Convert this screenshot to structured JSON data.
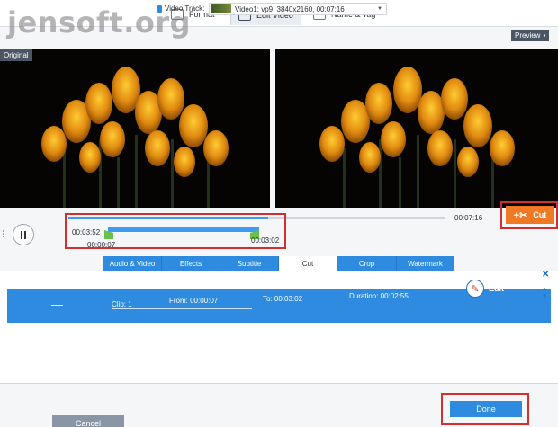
{
  "watermark": "jensoft.org",
  "tabs": [
    {
      "label": "Format",
      "icon": "format-icon"
    },
    {
      "label": "Edit Video",
      "icon": "film-icon"
    },
    {
      "label": "Name & Tag",
      "icon": "tag-icon"
    }
  ],
  "track": {
    "label": "Video Track:",
    "value": "Video1: vp9, 3840x2160, 00:07:16"
  },
  "panes": {
    "original_label": "Original",
    "preview_label": "Preview"
  },
  "timeline": {
    "current": "00:03:52",
    "end": "00:07:16",
    "start_mark": "00:00:07",
    "stop_mark": "00:03:02",
    "progress": 0.53
  },
  "cut_button": "Cut",
  "edit_tabs": [
    "Audio & Video",
    "Effects",
    "Subtitle",
    "Cut",
    "Crop",
    "Watermark"
  ],
  "clip": {
    "clip": "Clip: 1",
    "from": "From:  00:00:07",
    "to": "To:  00:03:02",
    "duration": "Duration:  00:02:55",
    "edit_label": "Edit"
  },
  "buttons": {
    "done": "Done",
    "cancel": "Cancel"
  },
  "colors": {
    "accent": "#2f8be0",
    "cut": "#ef7a23",
    "highlight": "#d32f2f"
  }
}
